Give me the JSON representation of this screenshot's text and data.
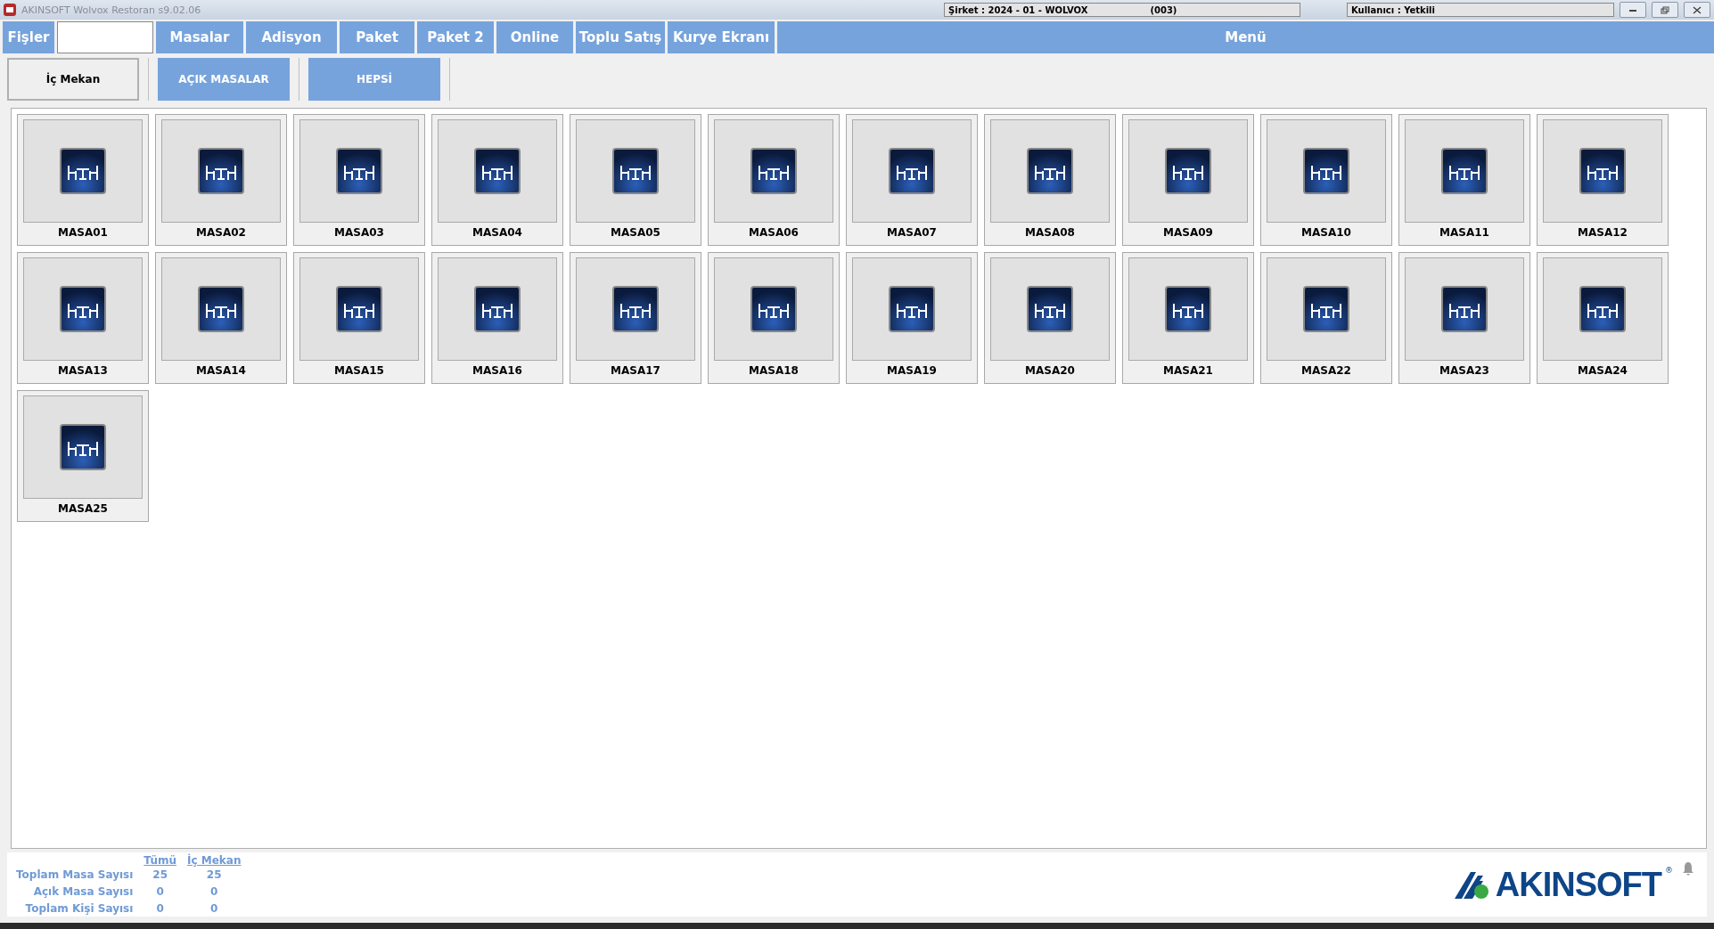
{
  "window": {
    "title": "AKINSOFT Wolvox Restoran s9.02.06",
    "company": "Şirket : 2024 - 01 - WOLVOX",
    "company_code": "(003)",
    "user": "Kullanıcı : Yetkili"
  },
  "menu_bar": {
    "first": "Fişler",
    "items": [
      "Masalar",
      "Adisyon",
      "Paket",
      "Paket 2",
      "Online",
      "Toplu Satış",
      "Kurye Ekranı"
    ],
    "menu": "Menü"
  },
  "tabs": [
    {
      "label": "İç Mekan",
      "selected": true
    },
    {
      "label": "AÇIK MASALAR",
      "selected": false
    },
    {
      "label": "HEPSİ",
      "selected": false
    }
  ],
  "tables": [
    "MASA01",
    "MASA02",
    "MASA03",
    "MASA04",
    "MASA05",
    "MASA06",
    "MASA07",
    "MASA08",
    "MASA09",
    "MASA10",
    "MASA11",
    "MASA12",
    "MASA13",
    "MASA14",
    "MASA15",
    "MASA16",
    "MASA17",
    "MASA18",
    "MASA19",
    "MASA20",
    "MASA21",
    "MASA22",
    "MASA23",
    "MASA24",
    "MASA25"
  ],
  "summary": {
    "columns": [
      "Tümü",
      "İç Mekan"
    ],
    "rows": [
      {
        "label": "Toplam Masa Sayısı",
        "values": [
          "25",
          "25"
        ]
      },
      {
        "label": "Açık Masa Sayısı",
        "values": [
          "0",
          "0"
        ]
      },
      {
        "label": "Toplam Kişi Sayısı",
        "values": [
          "0",
          "0"
        ]
      }
    ]
  },
  "logo": {
    "text": "AKINSOFT",
    "mark": "®"
  }
}
